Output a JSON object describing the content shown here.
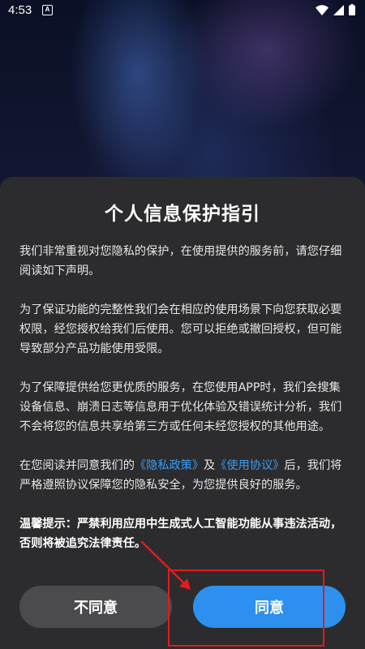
{
  "status_bar": {
    "time": "4:53",
    "app_icon": "A",
    "icons": [
      "wifi-icon",
      "signal-icon",
      "battery-icon"
    ]
  },
  "dialog": {
    "title": "个人信息保护指引",
    "para1": "我们非常重视对您隐私的保护，在使用提供的服务前，请您仔细阅读如下声明。",
    "para2": "为了保证功能的完整性我们会在相应的使用场景下向您获取必要权限，经您授权给我们后使用。您可以拒绝或撤回授权，但可能导致部分产品功能使用受限。",
    "para3": "为了保障提供给您更优质的服务，在您使用APP时，我们会搜集设备信息、崩溃日志等信息用于优化体验及错误统计分析，我们不会将您的信息共享给第三方或任何未经您授权的其他用途。",
    "para4": {
      "prefix": "在您阅读并同意我们的",
      "privacy_link": "《隐私政策》",
      "middle": "及",
      "terms_link": "《使用协议》",
      "suffix": "后，我们将严格遵照协议保障您的隐私安全，为您提供良好的服务。"
    },
    "warning": "温馨提示：严禁利用应用中生成式人工智能功能从事违法活动，否则将被追究法律责任。",
    "disagree_label": "不同意",
    "agree_label": "同意"
  },
  "colors": {
    "dialog_bg": "#2c2c2e",
    "agree_button": "#2e90ee",
    "disagree_button": "#4b4b4d",
    "link": "#3b9cf5",
    "annotation": "#e31b1b"
  }
}
